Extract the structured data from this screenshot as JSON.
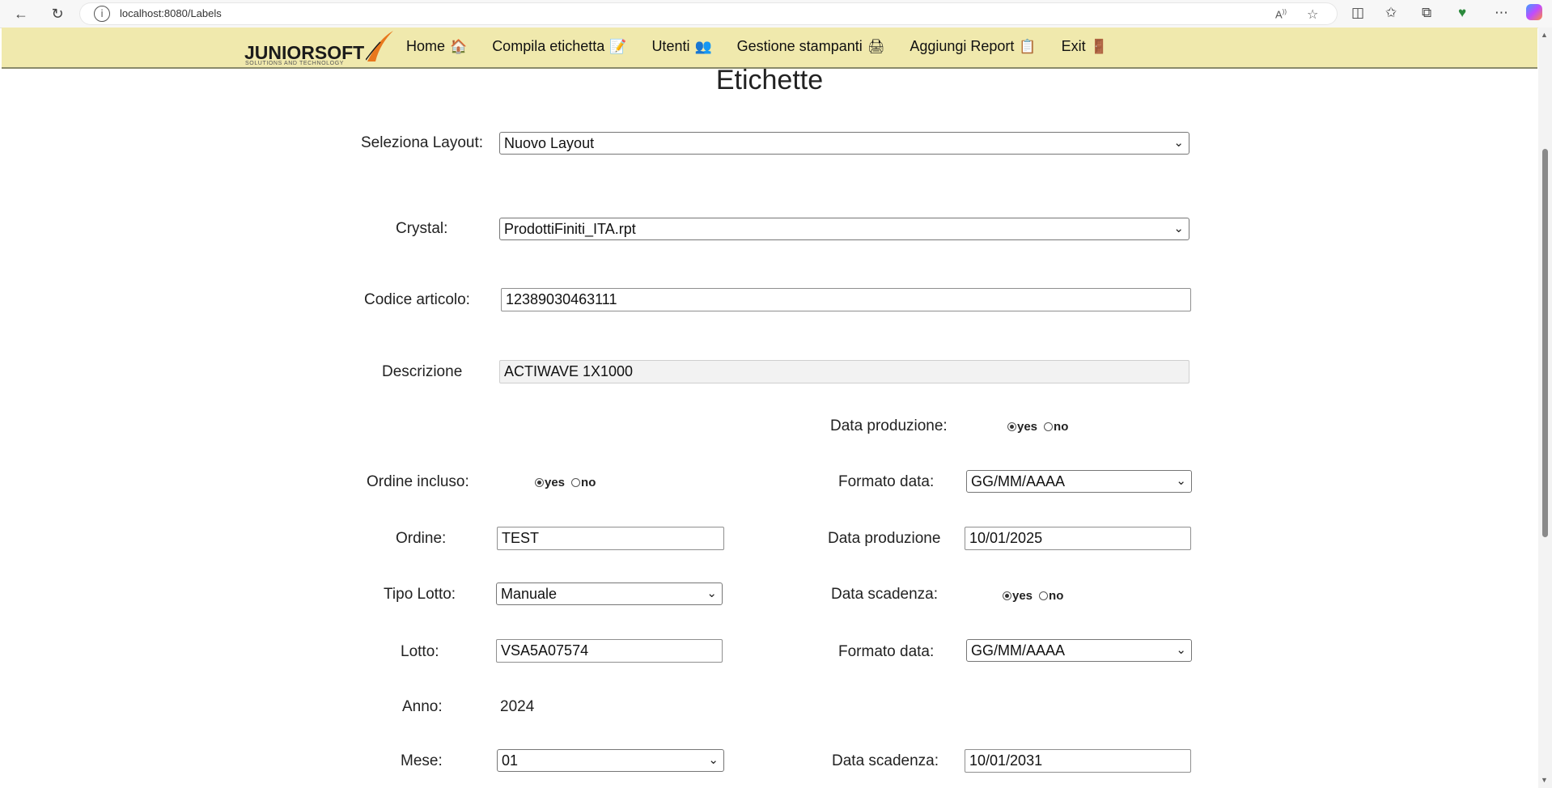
{
  "browser": {
    "url": "localhost:8080/Labels"
  },
  "header": {
    "logo_text": "JUNIORSOFT",
    "logo_tagline": "SOLUTIONS AND TECHNOLOGY",
    "menu": [
      {
        "label": "Home",
        "icon": "🏠"
      },
      {
        "label": "Compila etichetta",
        "icon": "📝"
      },
      {
        "label": "Utenti",
        "icon": "👥"
      },
      {
        "label": "Gestione stampanti",
        "icon": "🖨"
      },
      {
        "label": "Aggiungi Report",
        "icon": "📋"
      },
      {
        "label": "Exit",
        "icon": "🚪"
      }
    ]
  },
  "form": {
    "title": "Etichette",
    "layout_label": "Seleziona Layout:",
    "layout_value": "Nuovo Layout",
    "crystal_label": "Crystal:",
    "crystal_value": "ProdottiFiniti_ITA.rpt",
    "codice_label": "Codice articolo:",
    "codice_value": "12389030463111",
    "descrizione_label": "Descrizione",
    "descrizione_value": "ACTIWAVE 1X1000",
    "data_produzione_toggle_label": "Data produzione:",
    "ordine_incluso_label": "Ordine incluso:",
    "formato_data_label": "Formato data:",
    "formato_data_value": "GG/MM/AAAA",
    "ordine_label": "Ordine:",
    "ordine_value": "TEST",
    "data_produzione_label": "Data produzione",
    "data_produzione_value": "10/01/2025",
    "tipo_lotto_label": "Tipo Lotto:",
    "tipo_lotto_value": "Manuale",
    "data_scadenza_toggle_label": "Data scadenza:",
    "lotto_label": "Lotto:",
    "lotto_value": "VSA5A07574",
    "formato_data2_label": "Formato data:",
    "formato_data2_value": "GG/MM/AAAA",
    "anno_label": "Anno:",
    "anno_value": "2024",
    "mese_label": "Mese:",
    "mese_value": "01",
    "data_scadenza_label": "Data scadenza:",
    "data_scadenza_value": "10/01/2031",
    "yes": "yes",
    "no": "no"
  }
}
